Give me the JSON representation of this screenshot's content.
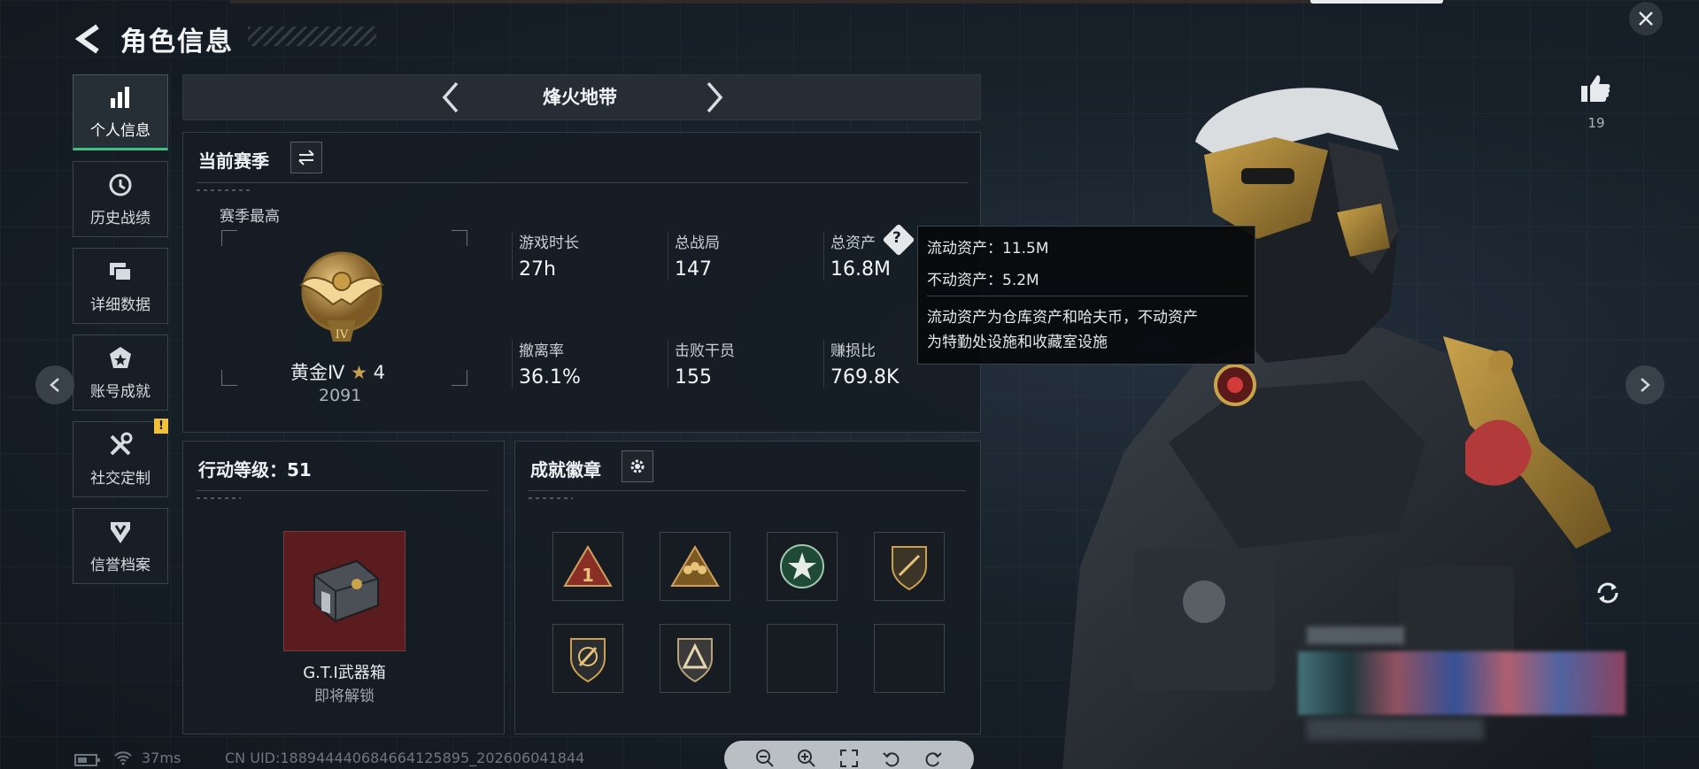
{
  "header": {
    "title": "角色信息"
  },
  "sidebar": {
    "items": [
      {
        "label": "个人信息",
        "icon": "bar-chart-icon",
        "active": true
      },
      {
        "label": "历史战绩",
        "icon": "history-icon"
      },
      {
        "label": "详细数据",
        "icon": "files-icon"
      },
      {
        "label": "账号成就",
        "icon": "medal-icon"
      },
      {
        "label": "社交定制",
        "icon": "wrench-icon"
      },
      {
        "label": "信誉档案",
        "icon": "shield-icon"
      }
    ],
    "warning_badge": "!"
  },
  "mode": {
    "title": "烽火地带"
  },
  "season": {
    "title": "当前赛季",
    "best_label": "赛季最高",
    "rank_name": "黄金Ⅳ",
    "rank_star": "★",
    "rank_stars": "4",
    "rank_score": "2091",
    "rank_numeral": "IV",
    "stats": [
      {
        "label": "游戏时长",
        "value": "27h"
      },
      {
        "label": "总战局",
        "value": "147"
      },
      {
        "label": "总资产",
        "value": "16.8M"
      },
      {
        "label": "撤离率",
        "value": "36.1%"
      },
      {
        "label": "击败干员",
        "value": "155"
      },
      {
        "label": "赚损比",
        "value": "769.8K"
      }
    ]
  },
  "tooltip": {
    "liquid": "流动资产：11.5M",
    "fixed": "不动资产：5.2M",
    "desc_line1": "流动资产为仓库资产和哈夫币，不动资产",
    "desc_line2": "为特勤处设施和收藏室设施"
  },
  "action_level": {
    "title": "行动等级：51",
    "reward_name": "G.T.I武器箱",
    "reward_status": "即将解锁"
  },
  "badges": {
    "title": "成就徽章",
    "slots": [
      "triangle-1-badge",
      "squad-badge",
      "green-star-badge",
      "shield-blade-badge",
      "shield-knife-badge",
      "triangle-emblem-badge",
      "empty",
      "empty"
    ]
  },
  "likes": {
    "count": "19"
  },
  "status": {
    "ping": "37ms",
    "uid": "CN UID:1889444406846641258​95_202606041844"
  },
  "colors": {
    "accent": "#3fc183",
    "warning": "#f0c23a",
    "rank_gold": "#c9a050"
  }
}
